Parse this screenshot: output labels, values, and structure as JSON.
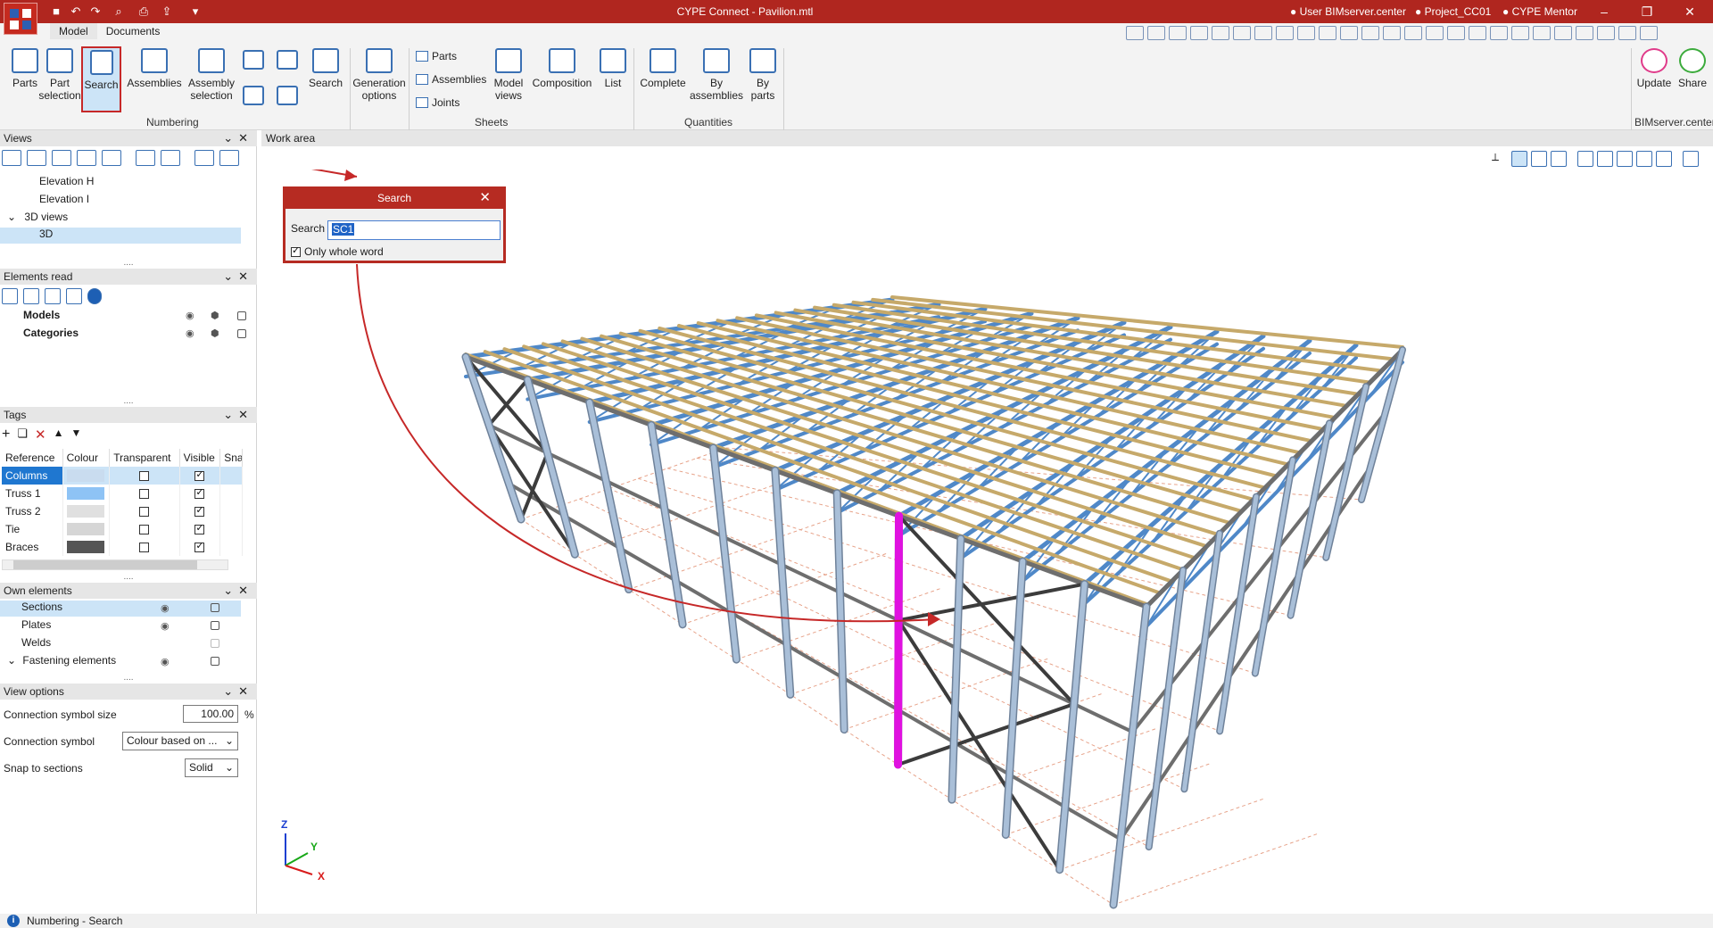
{
  "window": {
    "title": "CYPE Connect - Pavilion.mtl",
    "user": "User BIMserver.center",
    "project": "Project_CC01",
    "mentor": "CYPE Mentor"
  },
  "menu_tabs": [
    "Model",
    "Documents"
  ],
  "ribbon": {
    "buttons": {
      "parts": "Parts",
      "part_selection": "Part\nselection",
      "search": "Search",
      "assemblies": "Assemblies",
      "assembly_selection": "Assembly\nselection",
      "search2": "Search",
      "generation_options": "Generation\noptions",
      "model_views": "Model\nviews",
      "composition": "Composition",
      "list": "List",
      "complete": "Complete",
      "by_assemblies": "By\nassemblies",
      "by_parts": "By\nparts",
      "update": "Update",
      "share": "Share"
    },
    "sheets_small": [
      "Parts",
      "Assemblies",
      "Joints"
    ],
    "groups": {
      "numbering": "Numbering",
      "sheets": "Sheets",
      "quantities": "Quantities",
      "bimserver": "BIMserver.center"
    }
  },
  "panels": {
    "views": {
      "title": "Views",
      "items": [
        "Elevation H",
        "Elevation I",
        "3D views",
        "3D"
      ]
    },
    "elements_read": {
      "title": "Elements read",
      "items": [
        "Models",
        "Categories"
      ]
    },
    "tags": {
      "title": "Tags",
      "columns": [
        "Reference",
        "Colour",
        "Transparent",
        "Visible",
        "Snap"
      ],
      "rows": [
        {
          "reference": "Columns",
          "colour": "#c9dcef",
          "transparent": false,
          "visible": true
        },
        {
          "reference": "Truss 1",
          "colour": "#8ec3f5",
          "transparent": false,
          "visible": true
        },
        {
          "reference": "Truss 2",
          "colour": "#e0e0e0",
          "transparent": false,
          "visible": true
        },
        {
          "reference": "Tie",
          "colour": "#d6d6d6",
          "transparent": false,
          "visible": true
        },
        {
          "reference": "Braces",
          "colour": "#555555",
          "transparent": false,
          "visible": true
        }
      ]
    },
    "own_elements": {
      "title": "Own elements",
      "items": [
        "Sections",
        "Plates",
        "Welds",
        "Fastening elements"
      ]
    },
    "view_options": {
      "title": "View options",
      "connection_symbol_size_label": "Connection symbol size",
      "connection_symbol_size_value": "100.00",
      "percent": "%",
      "connection_symbol_label": "Connection symbol",
      "connection_symbol_value": "Colour based on ...",
      "snap_label": "Snap to sections",
      "snap_value": "Solid"
    }
  },
  "work_area": {
    "title": "Work area"
  },
  "search_dialog": {
    "title": "Search",
    "label": "Search",
    "value": "SC1",
    "checkbox_label": "Only whole word",
    "checked": true
  },
  "axes": {
    "z": "Z",
    "y": "Y",
    "x": "X"
  },
  "status": "Numbering - Search",
  "colors": {
    "titlebar": "#b0261f",
    "highlight": "#c62828",
    "selected_column": "#e011e0",
    "column_steel": "#a9bfd8",
    "truss_blue": "#4f88c8",
    "purlin_gold": "#c6a96a",
    "brace_dark": "#3c3c3c"
  }
}
